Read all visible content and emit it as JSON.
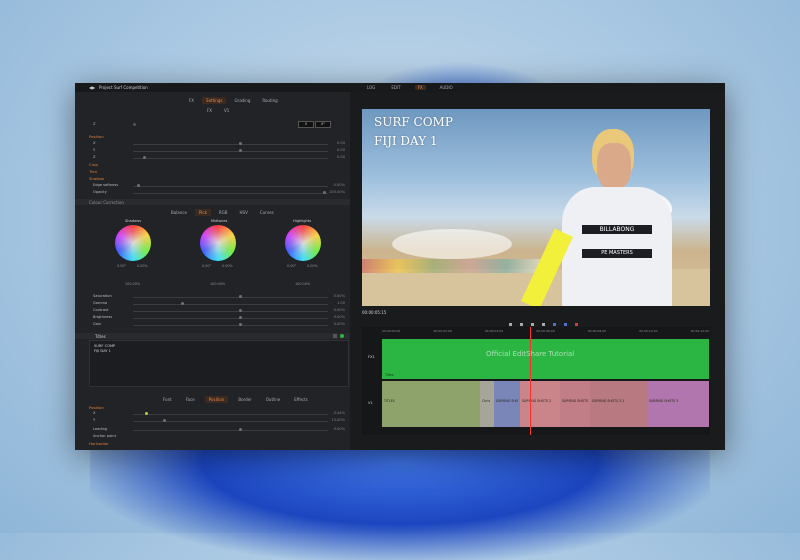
{
  "app": {
    "project_title": "Project Surf Competition",
    "top_tabs": [
      "LOG",
      "EDIT",
      "FX",
      "AUDIO"
    ],
    "active_top_tab": "FX"
  },
  "inspector": {
    "tabs": [
      "FX",
      "Settings",
      "Grading",
      "Routing"
    ],
    "subtabs": [
      "FX",
      "V1"
    ],
    "fx_value_left": "0",
    "fx_value_right": "0°",
    "position_section": "Position",
    "position_rows": [
      {
        "label": "X",
        "value": "0.00"
      },
      {
        "label": "Y",
        "value": "0.00"
      },
      {
        "label": "Z",
        "value": "0.00"
      }
    ],
    "sections": [
      "Crop",
      "Trim",
      "Shadow"
    ],
    "edge_softness": {
      "label": "Edge softness",
      "value": "0.00%"
    },
    "opacity": {
      "label": "Opacity",
      "value": "100.00%"
    },
    "color_section": "Colour Correction",
    "color_tabs": [
      "Balance",
      "Pick",
      "RGB",
      "HSV",
      "Curves"
    ],
    "wheels": [
      {
        "label": "Shadows",
        "v1": "0.00°",
        "v2": "0.00%",
        "bottom": "100.00%"
      },
      {
        "label": "Midtones",
        "v1": "0.00°",
        "v2": "0.00%",
        "bottom": "100.00%"
      },
      {
        "label": "Highlights",
        "v1": "0.00°",
        "v2": "0.00%",
        "bottom": "100.00%"
      }
    ],
    "adjust_rows": [
      {
        "label": "Saturation",
        "value": "0.00%"
      },
      {
        "label": "Gamma",
        "value": "1.00"
      },
      {
        "label": "Contrast",
        "value": "0.00%"
      },
      {
        "label": "Brightness",
        "value": "0.00%"
      },
      {
        "label": "Gain",
        "value": "0.00%"
      }
    ],
    "titles_section": "Titles",
    "title_text_line1": "SURF COMP",
    "title_text_line2": "FIJI DAY 1",
    "text_tabs": [
      "Font",
      "Face",
      "Position",
      "Border",
      "Outline",
      "Effects"
    ],
    "active_text_tab": "Position",
    "text_position_rows": [
      {
        "label": "X",
        "value": "-3.44%"
      },
      {
        "label": "Y",
        "value": "13.00%"
      }
    ],
    "leading": {
      "label": "Leading",
      "value": "0.00%"
    },
    "anchor": {
      "label": "Anchor point",
      "value": ""
    },
    "horizontal": "Horizontal"
  },
  "viewer": {
    "sequence_label": "Sequence 01",
    "sequence_sub": "Yesterday source (1)",
    "overlay_line1": "SURF COMP",
    "overlay_line2": "FIJI DAY 1",
    "timecode": "00:00:05:15",
    "jersey_text1": "BILLABONG",
    "jersey_text2": "PE MASTERS"
  },
  "timeline": {
    "ruler": [
      "00:00:00:00",
      "00:00:02:00",
      "00:00:04:00",
      "00:00:06:00",
      "00:00:08:00",
      "00:00:10:00",
      "00:00:12:00"
    ],
    "track_fx": "FX1",
    "track_v": "V1",
    "fx_clip_label": "Titles",
    "clips": [
      "TITLES",
      "Chris",
      "SURFING SHO",
      "SURFING SHOTS 2",
      "SURFING SHOTS",
      "SURFING SHOTS 3.1",
      "SURFING SHOTS 3"
    ]
  },
  "watermark": "Official EditShare Tutorial",
  "colors": {
    "accent": "#e0803a",
    "fx_track": "#2bb542",
    "playhead": "#ff3030"
  }
}
